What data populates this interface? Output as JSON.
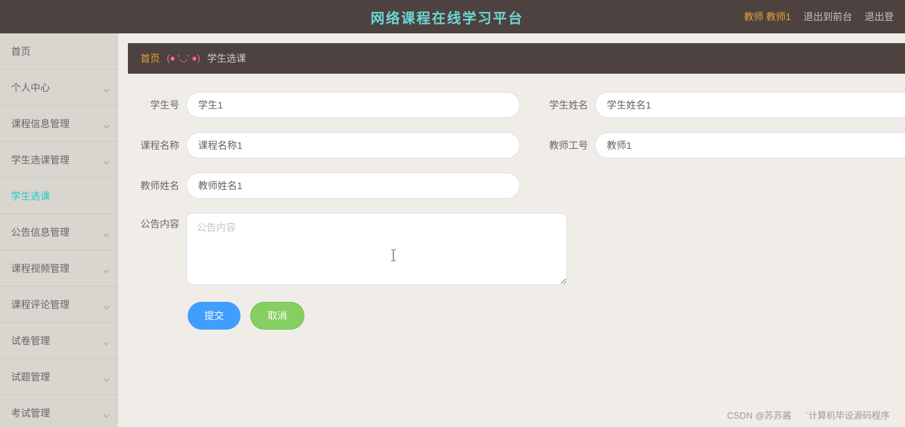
{
  "header": {
    "title": "网络课程在线学习平台",
    "user_label": "教师 教师1",
    "logout_front": "退出到前台",
    "logout": "退出登"
  },
  "sidebar": {
    "items": [
      {
        "label": "首页",
        "has_chevron": false,
        "active": false
      },
      {
        "label": "个人中心",
        "has_chevron": true,
        "active": false
      },
      {
        "label": "课程信息管理",
        "has_chevron": true,
        "active": false
      },
      {
        "label": "学生选课管理",
        "has_chevron": true,
        "active": false
      },
      {
        "label": "学生选课",
        "has_chevron": false,
        "active": true
      },
      {
        "label": "公告信息管理",
        "has_chevron": true,
        "active": false
      },
      {
        "label": "课程视频管理",
        "has_chevron": true,
        "active": false
      },
      {
        "label": "课程评论管理",
        "has_chevron": true,
        "active": false
      },
      {
        "label": "试卷管理",
        "has_chevron": true,
        "active": false
      },
      {
        "label": "试题管理",
        "has_chevron": true,
        "active": false
      },
      {
        "label": "考试管理",
        "has_chevron": true,
        "active": false
      }
    ]
  },
  "breadcrumb": {
    "home": "首页",
    "face": "(● '◡' ●)",
    "current": "学生选课"
  },
  "form": {
    "student_id_label": "学生号",
    "student_id_value": "学生1",
    "student_name_label": "学生姓名",
    "student_name_value": "学生姓名1",
    "course_name_label": "课程名称",
    "course_name_value": "课程名称1",
    "teacher_id_label": "教师工号",
    "teacher_id_value": "教师1",
    "teacher_name_label": "教师姓名",
    "teacher_name_value": "教师姓名1",
    "notice_label": "公告内容",
    "notice_placeholder": "公告内容",
    "notice_value": "",
    "submit_label": "提交",
    "cancel_label": "取消"
  },
  "watermark": {
    "left": "CSDN @苏苏酱",
    "right": "`计算机毕设源码程序"
  }
}
